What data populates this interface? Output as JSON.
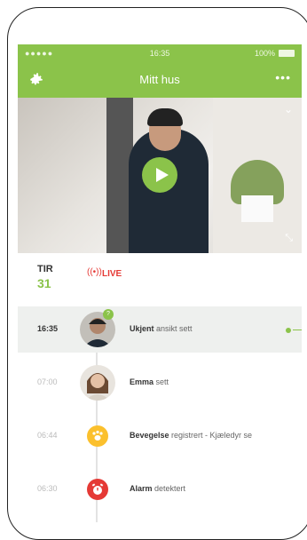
{
  "status": {
    "signal": "●●●●● ",
    "time": "16:35",
    "battery": "100%"
  },
  "appbar": {
    "title": "Mitt hus",
    "more": "•••"
  },
  "video": {
    "chevron": "⌄",
    "expand": "⤡"
  },
  "timeline": {
    "header": {
      "day": "TIR",
      "date": "31",
      "live": "LIVE",
      "live_icon": "((•))"
    },
    "events": [
      {
        "time": "16:35",
        "bold": "Ukjent",
        "rest": " ansikt sett",
        "badge": "?"
      },
      {
        "time": "07:00",
        "bold": "Emma",
        "rest": " sett"
      },
      {
        "time": "06:44",
        "bold": "Bevegelse",
        "rest": " registrert - Kjæledyr se"
      },
      {
        "time": "06:30",
        "bold": "Alarm",
        "rest": " detektert"
      }
    ]
  },
  "colors": {
    "accent": "#8bc34a",
    "alert": "#e53935",
    "pet": "#fbc02d"
  }
}
